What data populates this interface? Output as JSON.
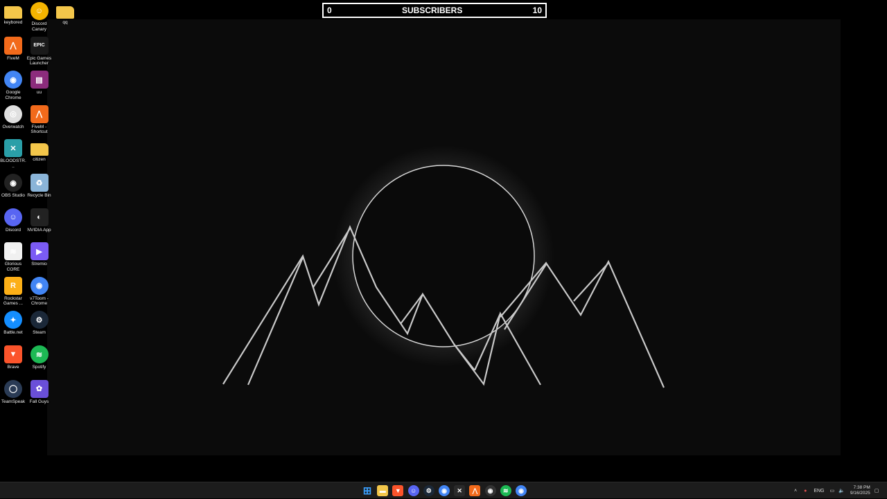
{
  "widget": {
    "left_count": "0",
    "title": "SUBSCRIBERS",
    "right_count": "10"
  },
  "desktop_icons": [
    {
      "label": "keybored",
      "icon": "folder-icon",
      "color": "#f3c64a"
    },
    {
      "label": "Discord Canary",
      "icon": "discord-canary-icon",
      "color": "#f4b400"
    },
    {
      "label": "qq",
      "icon": "folder-icon",
      "color": "#f3c64a"
    },
    {
      "label": "FiveM",
      "icon": "fivem-icon",
      "color": "#f26a1b"
    },
    {
      "label": "Epic Games Launcher",
      "icon": "epic-games-icon",
      "color": "#1a1a1a"
    },
    {
      "label": "Google Chrome",
      "icon": "chrome-icon",
      "color": "#4285f4"
    },
    {
      "label": "uu",
      "icon": "winrar-icon",
      "color": "#8c2c7c"
    },
    {
      "label": "Overwatch",
      "icon": "overwatch-icon",
      "color": "#e0e0e0"
    },
    {
      "label": "FiveM - Shortcut",
      "icon": "fivem-icon",
      "color": "#f26a1b"
    },
    {
      "label": "BLOODSTR...",
      "icon": "bloodstrike-icon",
      "color": "#2a9fa8"
    },
    {
      "label": "citizen",
      "icon": "folder-icon",
      "color": "#f3c64a"
    },
    {
      "label": "OBS Studio",
      "icon": "obs-icon",
      "color": "#222"
    },
    {
      "label": "Recycle Bin",
      "icon": "recycle-bin-icon",
      "color": "#8ab4d8"
    },
    {
      "label": "Discord",
      "icon": "discord-icon",
      "color": "#5865f2"
    },
    {
      "label": "NVIDIA App",
      "icon": "nvidia-icon",
      "color": "#222"
    },
    {
      "label": "Glorious CORE",
      "icon": "glorious-core-icon",
      "color": "#f0f0f0"
    },
    {
      "label": "Stremio",
      "icon": "stremio-icon",
      "color": "#7b5bf5"
    },
    {
      "label": "Rockstar Games ...",
      "icon": "rockstar-icon",
      "color": "#fcaf17"
    },
    {
      "label": "v7Toom - Chrome",
      "icon": "chrome-icon",
      "color": "#4285f4"
    },
    {
      "label": "Battle.net",
      "icon": "battlenet-icon",
      "color": "#148eff"
    },
    {
      "label": "Steam",
      "icon": "steam-icon",
      "color": "#1b2838"
    },
    {
      "label": "Brave",
      "icon": "brave-icon",
      "color": "#fb542b"
    },
    {
      "label": "Spotify",
      "icon": "spotify-icon",
      "color": "#1db954"
    },
    {
      "label": "TeamSpeak",
      "icon": "teamspeak-icon",
      "color": "#2a3b55"
    },
    {
      "label": "Fall Guys",
      "icon": "fall-guys-icon",
      "color": "#6a4fd8"
    }
  ],
  "taskbar": {
    "apps": [
      {
        "name": "start-icon",
        "color": "#3aa0ff"
      },
      {
        "name": "file-explorer-icon",
        "color": "#f3c64a"
      },
      {
        "name": "brave-icon",
        "color": "#fb542b"
      },
      {
        "name": "discord-icon",
        "color": "#5865f2"
      },
      {
        "name": "steam-icon",
        "color": "#1b2838"
      },
      {
        "name": "chrome-icon",
        "color": "#4285f4"
      },
      {
        "name": "xbox-icon",
        "color": "#2a2a2a"
      },
      {
        "name": "fivem-icon",
        "color": "#f26a1b"
      },
      {
        "name": "obs-icon",
        "color": "#333"
      },
      {
        "name": "spotify-icon",
        "color": "#1db954"
      },
      {
        "name": "chrome-icon",
        "color": "#4285f4"
      }
    ],
    "language": "ENG",
    "time": "7:38 PM",
    "date": "9/16/2025"
  }
}
